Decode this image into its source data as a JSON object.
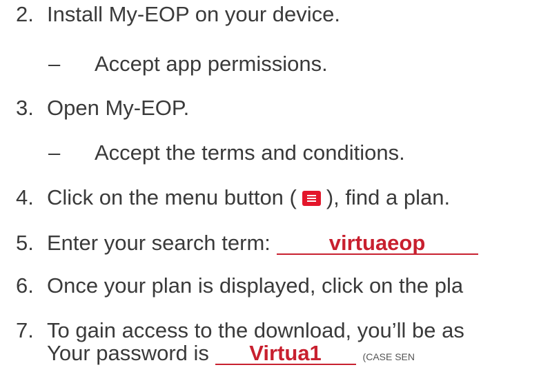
{
  "steps": [
    {
      "number": "2.",
      "text": "Install My-EOP on your device.",
      "sub": "Accept app permissions."
    },
    {
      "number": "3.",
      "text": "Open My-EOP.",
      "sub": "Accept the terms and conditions."
    },
    {
      "number": "4.",
      "text_before": "Click on the menu button (",
      "text_after": "), find a plan."
    },
    {
      "number": "5.",
      "text": "Enter your search term:",
      "value": "virtuaeop"
    },
    {
      "number": "6.",
      "text": "Once your plan is displayed, click on the pla"
    },
    {
      "number": "7.",
      "text": "To gain access to the download, you’ll be as",
      "text2": "Your password is",
      "value": "Virtua1",
      "note": "(CASE SEN"
    }
  ],
  "dash": "–",
  "accent_color": "#e3162b",
  "icons": {
    "menu": "hamburger-menu-icon"
  }
}
